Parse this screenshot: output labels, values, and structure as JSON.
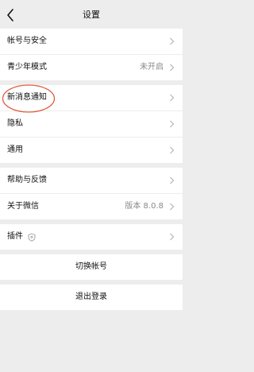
{
  "header": {
    "title": "设置"
  },
  "groups": {
    "g1": [
      {
        "label": "帐号与安全",
        "value": ""
      },
      {
        "label": "青少年模式",
        "value": "未开启"
      }
    ],
    "g2": [
      {
        "label": "新消息通知",
        "value": ""
      },
      {
        "label": "隐私",
        "value": ""
      },
      {
        "label": "通用",
        "value": ""
      }
    ],
    "g3": [
      {
        "label": "帮助与反馈",
        "value": ""
      },
      {
        "label": "关于微信",
        "value": "版本 8.0.8"
      }
    ],
    "g4": [
      {
        "label": "插件",
        "value": ""
      }
    ]
  },
  "actions": {
    "switch_account": "切换帐号",
    "logout": "退出登录"
  },
  "colors": {
    "background": "#ededed",
    "row_background": "#ffffff",
    "annotation": "#e05a3a"
  }
}
